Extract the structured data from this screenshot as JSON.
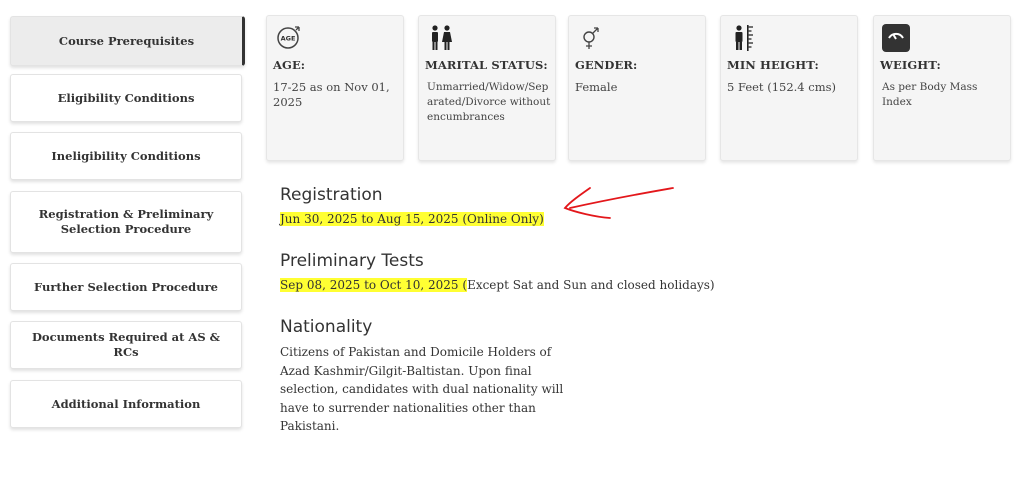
{
  "sidebar": {
    "items": [
      {
        "label": "Course Prerequisites"
      },
      {
        "label": "Eligibility Conditions"
      },
      {
        "label": "Ineligibility Conditions"
      },
      {
        "label": "Registration & Preliminary Selection Procedure"
      },
      {
        "label": "Further Selection Procedure"
      },
      {
        "label": "Documents Required at AS & RCs"
      },
      {
        "label": "Additional Information"
      }
    ]
  },
  "cards": [
    {
      "icon": "age-icon",
      "icon_text": "AGE",
      "label": "AGE:",
      "value": "17-25 as on Nov 01, 2025"
    },
    {
      "icon": "couple-icon",
      "label": "MARITAL STATUS:",
      "value": "Unmarried/Widow/Separated/Divorce without encumbrances"
    },
    {
      "icon": "gender-icon",
      "label": "GENDER:",
      "value": "Female"
    },
    {
      "icon": "height-icon",
      "label": "MIN HEIGHT:",
      "value": "5 Feet (152.4 cms)"
    },
    {
      "icon": "weight-scale-icon",
      "label": "WEIGHT:",
      "value": "As per Body Mass Index"
    }
  ],
  "registration": {
    "heading": "Registration",
    "dates": "Jun 30, 2025 to Aug 15, 2025 (Online Only)"
  },
  "preliminary": {
    "heading": "Preliminary Tests",
    "dates": "Sep 08, 2025 to Oct 10, 2025 (",
    "note": "Except Sat and Sun and closed holidays)"
  },
  "nationality": {
    "heading": "Nationality",
    "text": "Citizens of Pakistan and Domicile Holders of Azad Kashmir/Gilgit-Baltistan. Upon final selection, candidates with dual nationality will have to surrender nationalities other than Pakistani."
  },
  "colors": {
    "highlight": "#ffff33",
    "annotation_arrow": "#e3171b"
  }
}
